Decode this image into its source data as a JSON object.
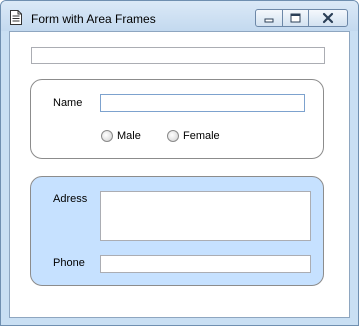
{
  "window": {
    "title": "Form with Area Frames",
    "icon": "document-icon",
    "controls": {
      "minimize": "minimize-icon",
      "maximize": "maximize-icon",
      "close": "close-icon"
    }
  },
  "form": {
    "top_field_value": "",
    "name": {
      "label": "Name",
      "value": ""
    },
    "gender": {
      "options": [
        {
          "label": "Male",
          "selected": false
        },
        {
          "label": "Female",
          "selected": false
        }
      ]
    },
    "adress": {
      "label": "Adress",
      "value": ""
    },
    "phone": {
      "label": "Phone",
      "value": ""
    }
  },
  "colors": {
    "frame2_background": "#c6e1ff",
    "window_frame": "#c9dff3"
  }
}
